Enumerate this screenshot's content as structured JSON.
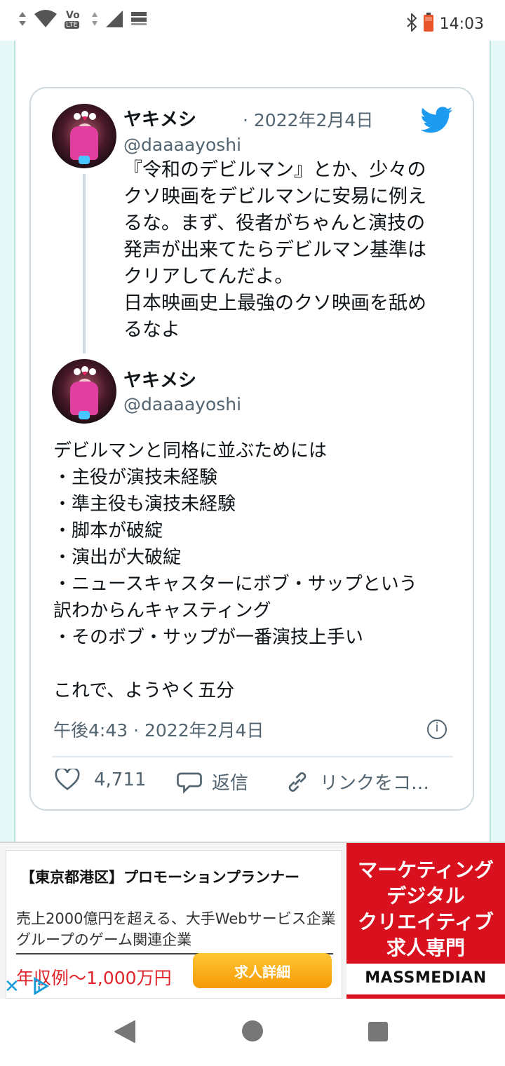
{
  "status_bar": {
    "time": "14:03",
    "network_label": "LTE",
    "icons": [
      "wifi-icon",
      "volte-icon",
      "signal-icon",
      "notification-icon",
      "bluetooth-icon",
      "battery-icon"
    ]
  },
  "tweet": {
    "parent": {
      "name": "ヤキメシ",
      "date": "· 2022年2月4日",
      "handle": "@daaaayoshi",
      "text": "『令和のデビルマン』とか、少々の\nクソ映画をデビルマンに安易に例え\nるな。まず、役者がちゃんと演技の\n発声が出来てたらデビルマン基準は\nクリアしてんだよ。\n日本映画史上最強のクソ映画を舐め\nるなよ"
    },
    "main": {
      "name": "ヤキメシ",
      "handle": "@daaaayoshi",
      "text": "デビルマンと同格に並ぶためには\n・主役が演技未経験\n・準主役も演技未経験\n・脚本が破綻\n・演出が大破綻\n・ニュースキャスターにボブ・サップという\n訳わからんキャスティング\n・そのボブ・サップが一番演技上手い\n\nこれで、ようやく五分",
      "timestamp": "午後4:43 · 2022年2月4日",
      "likes": "4,711",
      "reply_label": "返信",
      "copy_link_label": "リンクをコ…"
    },
    "brand_color": "#1d9bf0"
  },
  "ad": {
    "title": "【東京都港区】プロモーションプランナー",
    "description": "売上2000億円を超える、大手Webサービス企業グループのゲーム関連企業",
    "salary": "年収例〜1,000万円",
    "button": "求人詳細",
    "side_text": [
      "マーケティング",
      "デジタル",
      "クリエイティブ",
      "求人専門"
    ],
    "brand": "MASSMEDIAN",
    "close": "✕"
  }
}
